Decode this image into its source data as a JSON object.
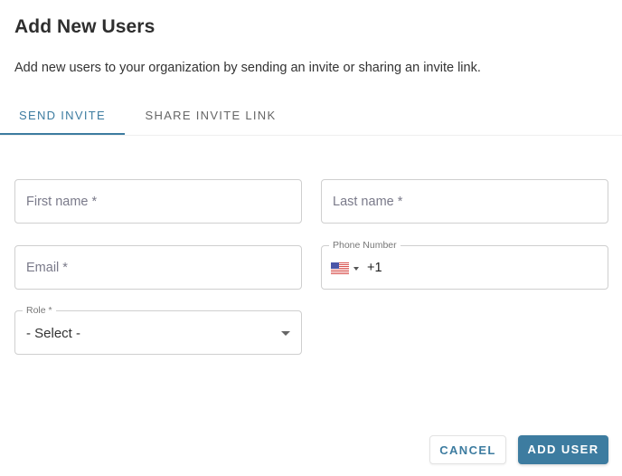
{
  "dialog": {
    "title": "Add New Users",
    "subtitle": "Add new users to your organization by sending an invite or sharing an invite link."
  },
  "tabs": [
    {
      "label": "SEND INVITE",
      "active": true
    },
    {
      "label": "SHARE INVITE LINK",
      "active": false
    }
  ],
  "form": {
    "first_name": {
      "placeholder": "First name *",
      "value": ""
    },
    "last_name": {
      "placeholder": "Last name *",
      "value": ""
    },
    "email": {
      "placeholder": "Email *",
      "value": ""
    },
    "phone": {
      "label": "Phone Number",
      "country": "us-flag-icon",
      "dial_code": "+1"
    },
    "role": {
      "label": "Role *",
      "selected": "- Select -"
    }
  },
  "actions": {
    "cancel_label": "CANCEL",
    "add_label": "ADD USER"
  },
  "colors": {
    "accent": "#3d7ca0"
  }
}
